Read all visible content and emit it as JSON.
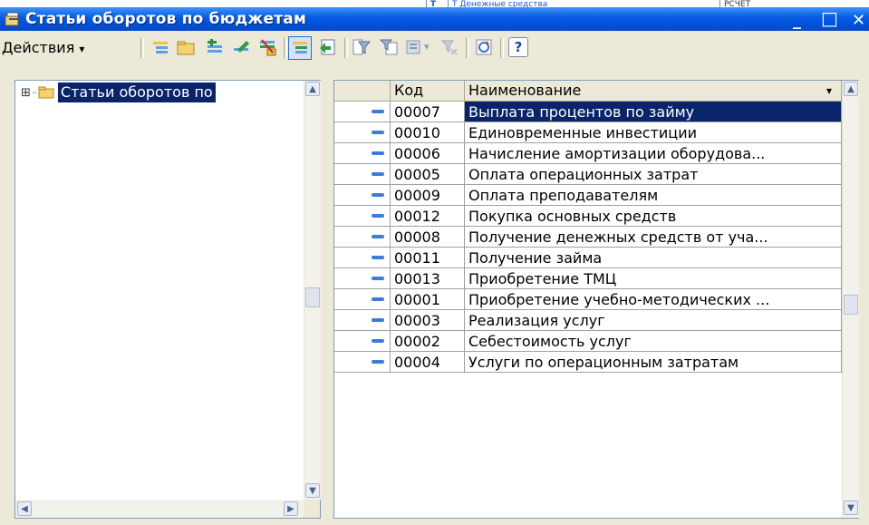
{
  "background_window": {
    "cell1": "Т",
    "cell2": "Т  Денежные средства",
    "cell3": "РСЧЕТ"
  },
  "window": {
    "title": "Статьи оборотов по бюджетам",
    "title_controls": {
      "minimize": "_",
      "maximize": "□",
      "close": "✕"
    }
  },
  "toolbar": {
    "actions_label": "Действия",
    "actions_arrow": "▾",
    "help_label": "?",
    "buttons": [
      "add-item-icon",
      "add-folder-icon",
      "add-copy-icon",
      "edit-icon",
      "delete-mark-icon",
      "hierarchy-view-icon",
      "parent-level-icon",
      "filter-icon",
      "filter-value-icon",
      "filter-history-icon",
      "filter-off-icon",
      "refresh-icon",
      "help-icon"
    ]
  },
  "tree": {
    "expander": "⊞",
    "root_label": "Статьи оборотов по"
  },
  "grid": {
    "columns": {
      "icon": "",
      "code": "Код",
      "name": "Наименование",
      "sort_arrow": "▾"
    },
    "rows": [
      {
        "code": "00007",
        "name": "Выплата процентов по займу",
        "selected": true
      },
      {
        "code": "00010",
        "name": "Единовременные инвестиции",
        "selected": false
      },
      {
        "code": "00006",
        "name": "Начисление амортизации оборудова...",
        "selected": false
      },
      {
        "code": "00005",
        "name": "Оплата операционных затрат",
        "selected": false
      },
      {
        "code": "00009",
        "name": "Оплата преподавателям",
        "selected": false
      },
      {
        "code": "00012",
        "name": "Покупка основных средств",
        "selected": false
      },
      {
        "code": "00008",
        "name": "Получение денежных средств от уча...",
        "selected": false
      },
      {
        "code": "00011",
        "name": "Получение займа",
        "selected": false
      },
      {
        "code": "00013",
        "name": "Приобретение ТМЦ",
        "selected": false
      },
      {
        "code": "00001",
        "name": "Приобретение учебно-методических ...",
        "selected": false
      },
      {
        "code": "00003",
        "name": "Реализация услуг",
        "selected": false
      },
      {
        "code": "00002",
        "name": "Себестоимость услуг",
        "selected": false
      },
      {
        "code": "00004",
        "name": "Услуги по операционным затратам",
        "selected": false
      }
    ]
  },
  "colors": {
    "titlebar": "#0054e3",
    "selection": "#0a246a",
    "row_icon": "#3b7bd9",
    "window_bg": "#ece9d8"
  }
}
